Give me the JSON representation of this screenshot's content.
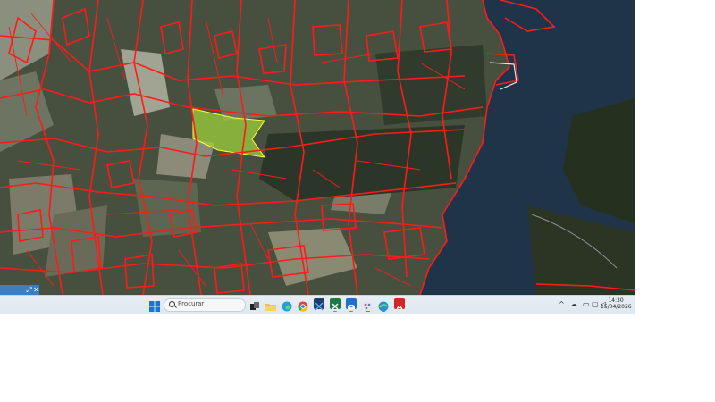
{
  "taskbar": {
    "search_placeholder": "Procurar",
    "apps": [
      {
        "name": "file-explorer-icon",
        "color": "#f3c242"
      },
      {
        "name": "edge-icon",
        "color": "#1fa0d8"
      },
      {
        "name": "chrome-icon",
        "color": "#e0453a"
      },
      {
        "name": "remote-app-icon",
        "color": "#1c3f6e"
      },
      {
        "name": "excel-icon",
        "color": "#1e7a43"
      },
      {
        "name": "outlook-icon",
        "color": "#1d6fd1"
      },
      {
        "name": "paint-icon",
        "color": "#c74b7a"
      },
      {
        "name": "map-app-icon",
        "color": "#2f8ecf"
      },
      {
        "name": "acrobat-icon",
        "color": "#d42424"
      }
    ],
    "clock": {
      "time": "14:30",
      "date": "15/04/2026"
    }
  },
  "map": {
    "parcel_outline_color": "#ff1a1a",
    "selected_parcel_color": "#9ccf3c",
    "water_color": "#1f3448",
    "land_color": "#3f4a3b"
  }
}
